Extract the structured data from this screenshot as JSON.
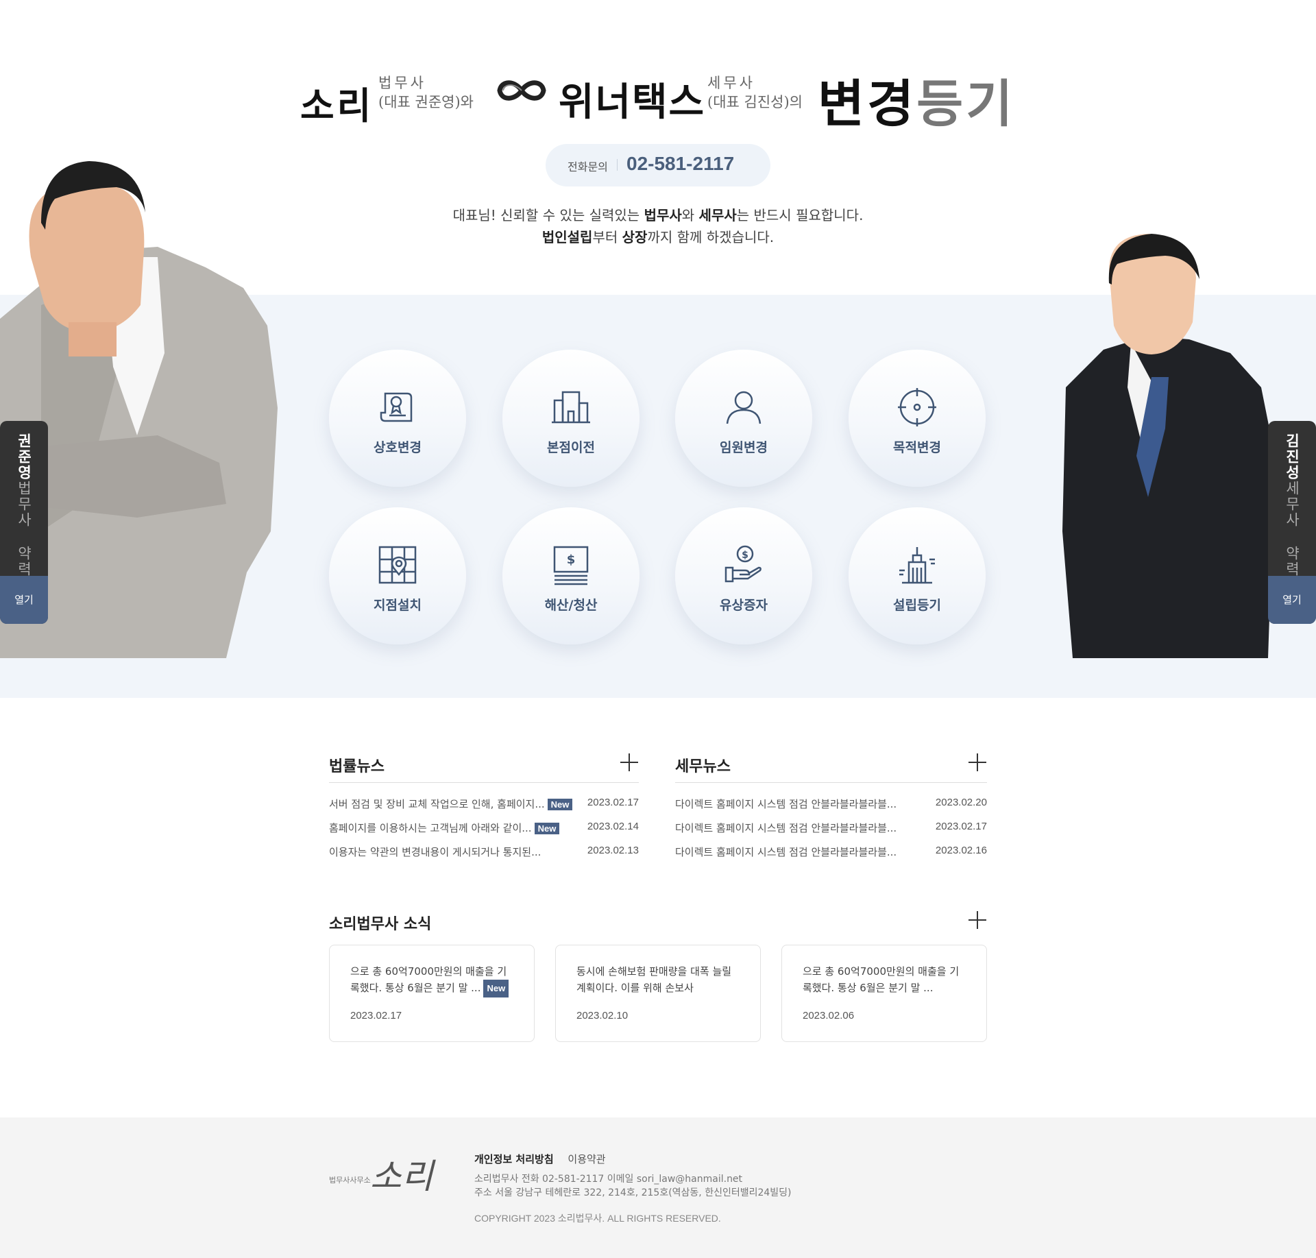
{
  "header": {
    "brand1": "소리",
    "brand1_role": "법무사",
    "brand1_rep": "(대표 권준영)와",
    "brand2": "위너택스",
    "brand2_role": "세무사",
    "brand2_rep": "(대표 김진성)의",
    "headline_a": "변경",
    "headline_b": "등기",
    "phone_label": "전화문의",
    "phone_number": "02-581-2117",
    "intro_line1_a": "대표님! 신뢰할 수 있는 실력있는 ",
    "intro_line1_b": "법무사",
    "intro_line1_c": "와 ",
    "intro_line1_d": "세무사",
    "intro_line1_e": "는 반드시 필요합니다.",
    "intro_line2_a": "법인설립",
    "intro_line2_b": "부터 ",
    "intro_line2_c": "상장",
    "intro_line2_d": "까지 함께 하겠습니다."
  },
  "services": [
    {
      "label": "상호변경",
      "icon": "certificate-scroll-icon"
    },
    {
      "label": "본점이전",
      "icon": "building-icon"
    },
    {
      "label": "임원변경",
      "icon": "person-icon"
    },
    {
      "label": "목적변경",
      "icon": "target-icon"
    },
    {
      "label": "지점설치",
      "icon": "map-pin-icon"
    },
    {
      "label": "해산/청산",
      "icon": "cash-register-icon"
    },
    {
      "label": "유상증자",
      "icon": "hand-coin-icon"
    },
    {
      "label": "설립등기",
      "icon": "city-building-icon"
    }
  ],
  "people": {
    "left": {
      "name": "권준영",
      "role": "법무사 약력",
      "open": "열기"
    },
    "right": {
      "name": "김진성",
      "role": "세무사 약력",
      "open": "열기"
    }
  },
  "law_news": {
    "title": "법률뉴스",
    "items": [
      {
        "title": "서버 점검 및 장비 교체 작업으로 인해, 홈페이지...",
        "new": "New",
        "date": "2023.02.17"
      },
      {
        "title": "홈페이지를 이용하시는 고객님께 아래와 같이...",
        "new": "New",
        "date": "2023.02.14"
      },
      {
        "title": "이용자는 약관의 변경내용이 게시되거나 통지된...",
        "new": "",
        "date": "2023.02.13"
      }
    ]
  },
  "tax_news": {
    "title": "세무뉴스",
    "items": [
      {
        "title": "다이렉트 홈페이지 시스템 점검 안블라블라블라블...",
        "date": "2023.02.20"
      },
      {
        "title": "다이렉트 홈페이지 시스템 점검 안블라블라블라블...",
        "date": "2023.02.17"
      },
      {
        "title": "다이렉트 홈페이지 시스템 점검 안블라블라블라블...",
        "date": "2023.02.16"
      }
    ]
  },
  "sori_news": {
    "title": "소리법무사 소식",
    "cards": [
      {
        "line1": "으로 총 60억7000만원의 매출을 기",
        "line2": "록했다. 통상 6월은 분기 말 ...",
        "new": "New",
        "date": "2023.02.17"
      },
      {
        "line1": "동시에 손해보험 판매량을 대폭 늘릴",
        "line2": "계획이다. 이를 위해 손보사",
        "new": "",
        "date": "2023.02.10"
      },
      {
        "line1": "으로 총 60억7000만원의 매출을 기",
        "line2": "록했다. 통상 6월은 분기 말 ...",
        "new": "",
        "date": "2023.02.06"
      }
    ]
  },
  "footer": {
    "logo_small": "법무사사무소",
    "logo_big": "소리",
    "privacy": "개인정보 처리방침",
    "terms": "이용약관",
    "info1": "소리법무사 전화 02-581-2117 이메일 sori_law@hanmail.net",
    "info2": "주소 서울 강남구 테헤란로 322, 214호, 215호(역삼동, 한신인터밸리24빌딩)",
    "copyright": "COPYRIGHT 2023 소리법무사. ALL RIGHTS RESERVED."
  },
  "colors": {
    "accent": "#4a6186",
    "band": "#f1f5fa",
    "icon": "#3f5573"
  }
}
